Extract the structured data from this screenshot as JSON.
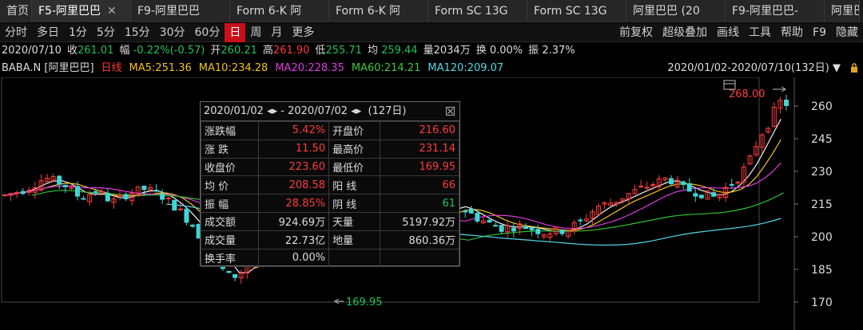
{
  "tabs": [
    {
      "label": "首页"
    },
    {
      "label": "F5-阿里巴巴",
      "close": "✕"
    },
    {
      "label": "F9-阿里巴巴"
    },
    {
      "label": "Form 6-K 阿"
    },
    {
      "label": "Form 6-K 阿"
    },
    {
      "label": "Form SC 13G"
    },
    {
      "label": "Form SC 13G"
    },
    {
      "label": "阿里巴巴 (20"
    },
    {
      "label": "F9-阿里巴巴-"
    },
    {
      "label": "阿里巴"
    }
  ],
  "toolbar": {
    "left": [
      "分时",
      "多日",
      "1分",
      "5分",
      "15分",
      "30分",
      "60分",
      "日",
      "周",
      "月",
      "更多"
    ],
    "selected": "日",
    "right": [
      "前复权",
      "超级叠加",
      "画线",
      "工具",
      "帮助",
      "F9",
      "隐藏"
    ]
  },
  "quote": {
    "date": "2020/07/10",
    "close_label": "收",
    "close": "261.01",
    "change_label": "幅",
    "change": "-0.22%(-0.57)",
    "open_label": "开",
    "open": "260.21",
    "high_label": "高",
    "high": "261.90",
    "low_label": "低",
    "low": "255.71",
    "avg_label": "均",
    "avg": "259.44",
    "vol_label": "量",
    "vol": "2034万",
    "turn_label": "换",
    "turn": "0.00%",
    "amp_label": "振",
    "amp": "2.37%"
  },
  "ma": {
    "symbol": "BABA.N [阿里巴巴]",
    "period": "日线",
    "ma5": "MA5:251.36",
    "ma10": "MA10:234.28",
    "ma20": "MA20:228.35",
    "ma60": "MA60:214.21",
    "ma120": "MA120:209.07",
    "range": "2020/01/02-2020/07/10(132日)"
  },
  "chart": {
    "y_ticks": [
      "260",
      "245",
      "230",
      "215",
      "200",
      "185",
      "170"
    ],
    "high_marker": "268.00",
    "low_marker": "169.95",
    "colors": {
      "up": "#ff3b3b",
      "down": "#3fd6d6",
      "ma5": "#f2f2f2",
      "ma10": "#f2c21a",
      "ma20": "#e03ae0",
      "ma60": "#2fc02f",
      "ma120": "#54d8e8"
    }
  },
  "popup": {
    "range_start": "2020/01/02",
    "range_end": "2020/07/02",
    "days": "(127日)",
    "rows": [
      [
        "涨跌幅",
        "5.42%",
        "开盘价",
        "216.60"
      ],
      [
        "涨  跌",
        "11.50",
        "最高价",
        "231.14"
      ],
      [
        "收盘价",
        "223.60",
        "最低价",
        "169.95"
      ],
      [
        "均  价",
        "208.58",
        "阳  线",
        "66"
      ],
      [
        "振  幅",
        "28.85%",
        "阴  线",
        "61"
      ],
      [
        "成交额",
        "924.69万",
        "天量",
        "5197.92万"
      ],
      [
        "成交量",
        "22.73亿",
        "地量",
        "860.36万"
      ],
      [
        "换手率",
        "0.00%",
        "",
        ""
      ]
    ]
  }
}
